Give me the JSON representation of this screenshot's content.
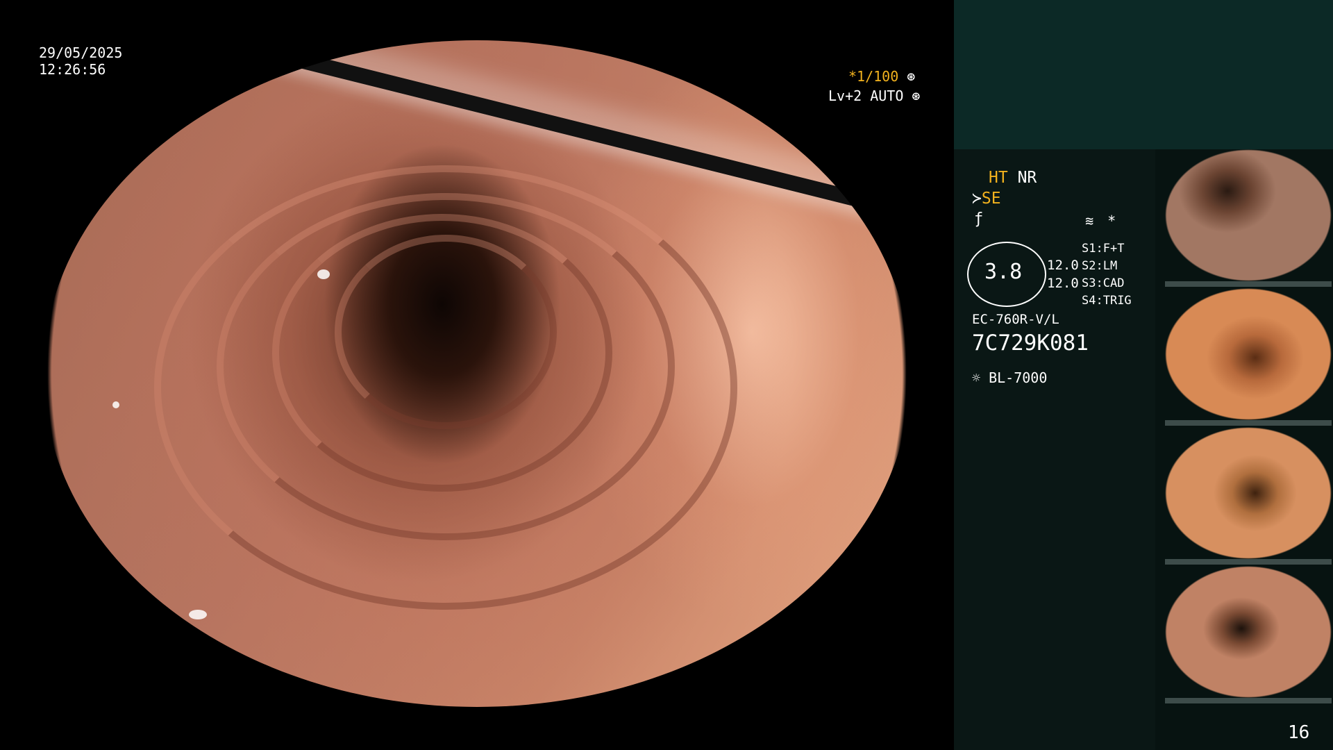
{
  "overlay": {
    "date": "29/05/2025",
    "time": "12:26:56",
    "shutter": "*1/100",
    "level": "Lv+2 AUTO"
  },
  "panel": {
    "ht": "HT",
    "nr": "NR",
    "se": "SE",
    "gauge_value": "3.8",
    "gauge_right": [
      "12.0",
      "12.0"
    ],
    "switches": [
      {
        "key": "S1:",
        "value": "F+T"
      },
      {
        "key": "S2:",
        "value": "LM"
      },
      {
        "key": "S3:",
        "value": "CAD"
      },
      {
        "key": "S4:",
        "value": "TRIG"
      }
    ],
    "scope_model": "EC-760R-V/L",
    "serial": "7C729K081",
    "light_source": "BL-7000",
    "page_number": "16"
  },
  "icons": {
    "shutter_wheel": "aperture-icon",
    "auto_wheel": "iris-icon",
    "se_icon": "se-curve-icon",
    "f_icon": "f-symbol-icon",
    "note_icon": "memo-icon",
    "asterisk": "asterisk-icon",
    "light": "sun-icon"
  },
  "thumbnails": [
    {
      "label": "capture 1"
    },
    {
      "label": "capture 2"
    },
    {
      "label": "capture 3"
    },
    {
      "label": "capture 4"
    }
  ],
  "colors": {
    "accent_yellow": "#f2b21e",
    "panel_dark": "#0a1715",
    "panel_header": "#0c2926"
  }
}
